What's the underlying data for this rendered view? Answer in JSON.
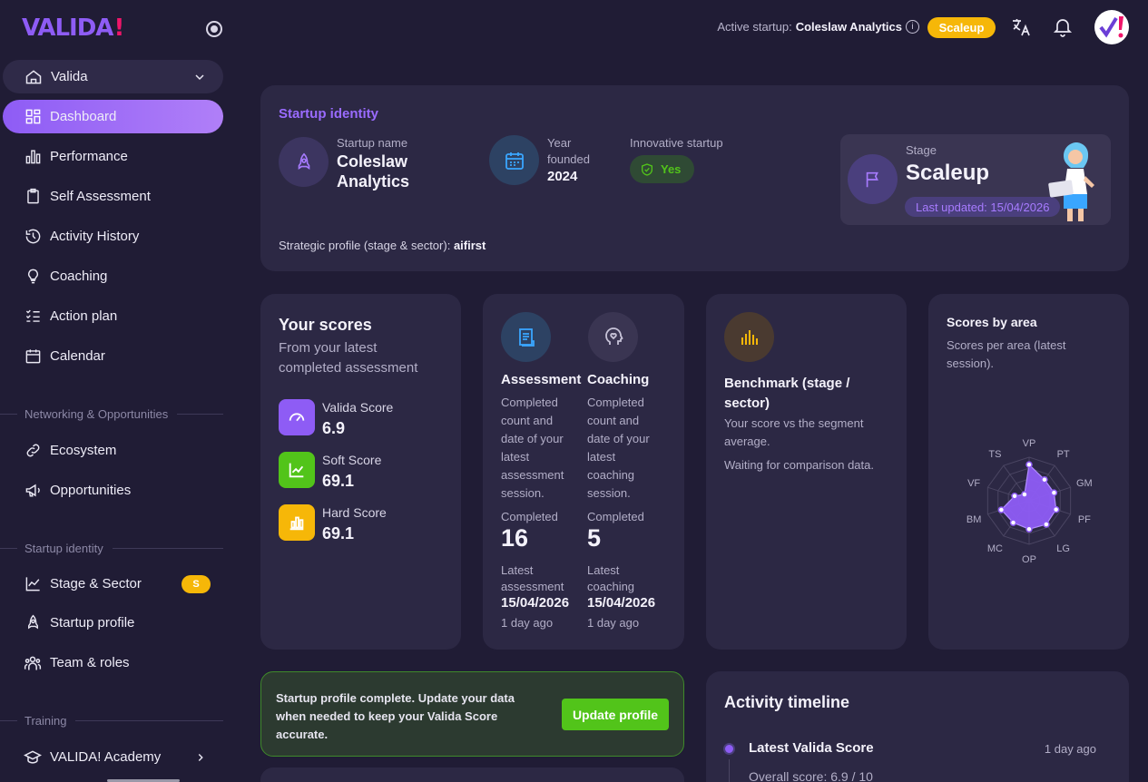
{
  "app": {
    "logo_text": "VALIDA",
    "logo_mark": "!"
  },
  "sidebar": {
    "workspace": "Valida",
    "items": [
      {
        "label": "Dashboard",
        "icon": "dashboard-icon"
      },
      {
        "label": "Performance",
        "icon": "bar-chart-icon"
      },
      {
        "label": "Self Assessment",
        "icon": "clipboard-icon"
      },
      {
        "label": "Activity History",
        "icon": "history-icon"
      },
      {
        "label": "Coaching",
        "icon": "lightbulb-icon"
      },
      {
        "label": "Action plan",
        "icon": "checklist-icon"
      },
      {
        "label": "Calendar",
        "icon": "calendar-icon"
      }
    ],
    "section_networking": "Networking & Opportunities",
    "networking_items": [
      {
        "label": "Ecosystem",
        "icon": "link-icon"
      },
      {
        "label": "Opportunities",
        "icon": "megaphone-icon"
      }
    ],
    "section_identity": "Startup identity",
    "identity_items": [
      {
        "label": "Stage & Sector",
        "icon": "trend-icon",
        "badge": "S"
      },
      {
        "label": "Startup profile",
        "icon": "rocket-icon"
      },
      {
        "label": "Team & roles",
        "icon": "team-icon"
      }
    ],
    "section_training": "Training",
    "training_items": [
      {
        "label": "VALIDA! Academy",
        "icon": "graduation-icon"
      }
    ]
  },
  "topbar": {
    "active_startup_label": "Active startup:",
    "active_startup_name": "Coleslaw Analytics",
    "info": "i",
    "stage_badge": "Scaleup"
  },
  "identity": {
    "title": "Startup identity",
    "startup_name_label": "Startup name",
    "startup_name_line1": "Coleslaw",
    "startup_name_line2": "Analytics",
    "year_label_line1": "Year",
    "year_label_line2": "founded",
    "year_value": "2024",
    "innovative_label": "Innovative startup",
    "innovative_value": "Yes",
    "stage_label": "Stage",
    "stage_value": "Scaleup",
    "last_updated": "Last updated: 15/04/2026",
    "strategic_label": "Strategic profile (stage & sector):",
    "strategic_value": "aifirst"
  },
  "scores": {
    "title": "Your scores",
    "subtitle_line1": "From your latest",
    "subtitle_line2": "completed assessment",
    "items": [
      {
        "label": "Valida Score",
        "value": "6.9",
        "color": "#8e5cf5"
      },
      {
        "label": "Soft Score",
        "value": "69.1",
        "color": "#52c41a"
      },
      {
        "label": "Hard Score",
        "value": "69.1",
        "color": "#f6b708"
      }
    ]
  },
  "activity": {
    "assessment": {
      "title": "Assessment",
      "desc": [
        "Completed",
        "count and",
        "date of your",
        "latest",
        "assessment",
        "session."
      ],
      "completed_label": "Completed",
      "completed_value": "16",
      "latest_label_1": "Latest",
      "latest_label_2": "assessment",
      "latest_date": "15/04/2026",
      "ago": "1 day ago"
    },
    "coaching": {
      "title": "Coaching",
      "desc": [
        "Completed",
        "count and",
        "date of your",
        "latest",
        "coaching",
        "session."
      ],
      "completed_label": "Completed",
      "completed_value": "5",
      "latest_label_1": "Latest",
      "latest_label_2": "coaching",
      "latest_date": "15/04/2026",
      "ago": "1 day ago"
    }
  },
  "benchmark": {
    "title_line1": "Benchmark (stage /",
    "title_line2": "sector)",
    "desc_line1": "Your score vs the segment",
    "desc_line2": "average.",
    "waiting": "Waiting for comparison data."
  },
  "radar": {
    "title": "Scores by area",
    "subtitle_line1": "Scores per area (latest",
    "subtitle_line2": "session).",
    "axes": [
      "VP",
      "PT",
      "GM",
      "PF",
      "LG",
      "OP",
      "MC",
      "BM",
      "VF",
      "TS"
    ],
    "values": [
      0.83,
      0.6,
      0.6,
      0.65,
      0.67,
      0.65,
      0.62,
      0.67,
      0.35,
      0.18
    ],
    "color": "#8e5cf5"
  },
  "profile_notice": {
    "text_line1": "Startup profile complete. Update your data",
    "text_line2": "when needed to keep your Valida Score",
    "text_line3": "accurate.",
    "button": "Update profile"
  },
  "timeline": {
    "title": "Activity timeline",
    "item_title": "Latest Valida Score",
    "item_time": "1 day ago",
    "item_detail": "Overall score: 6.9 / 10"
  },
  "colors": {
    "accent": "#8e5cf5",
    "warning": "#f6b708",
    "success": "#52c41a",
    "background": "#201c35",
    "card": "#2c2844"
  }
}
